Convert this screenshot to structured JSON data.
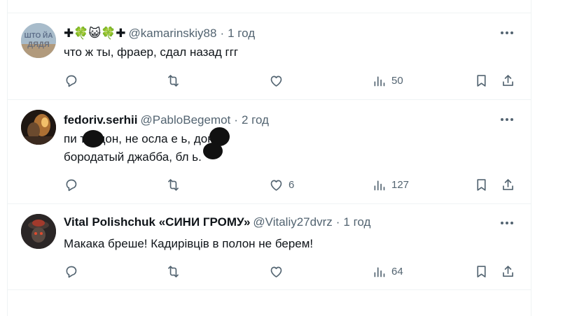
{
  "tweets": [
    {
      "name": "✚🍀😺🍀✚",
      "handle": "@kamarinskiy88",
      "separator": "·",
      "time": "1 год",
      "lines": [
        "что ж ты, фраер, сдал назад ггг"
      ],
      "replies": "",
      "retweets": "",
      "likes": "",
      "views": "50",
      "avatar_text": "ШТО ЙА ДЯДЯ"
    },
    {
      "name": "fedoriv.serhii",
      "handle": "@PabloBegemot",
      "separator": "·",
      "time": "2 год",
      "lines": [
        "пи    ть, дон, не осла е     ь, дон.",
        "бородатый джабба, бл   ь."
      ],
      "replies": "",
      "retweets": "",
      "likes": "6",
      "views": "127"
    },
    {
      "name": "Vital Polishchuk «СИНИ ГРОМУ»",
      "handle": "@Vitaliy27dvrz",
      "separator": "·",
      "time": "1 год",
      "lines": [
        "Макака бреше! Кадирівців в полон не берем!"
      ],
      "replies": "",
      "retweets": "",
      "likes": "",
      "views": "64"
    }
  ],
  "icons": {
    "reply": "reply-icon",
    "retweet": "retweet-icon",
    "like": "heart-icon",
    "views": "views-icon",
    "bookmark": "bookmark-icon",
    "share": "share-icon",
    "more": "more-icon"
  },
  "colors": {
    "text": "#0f1419",
    "secondary": "#536471",
    "border": "#eff3f4"
  }
}
